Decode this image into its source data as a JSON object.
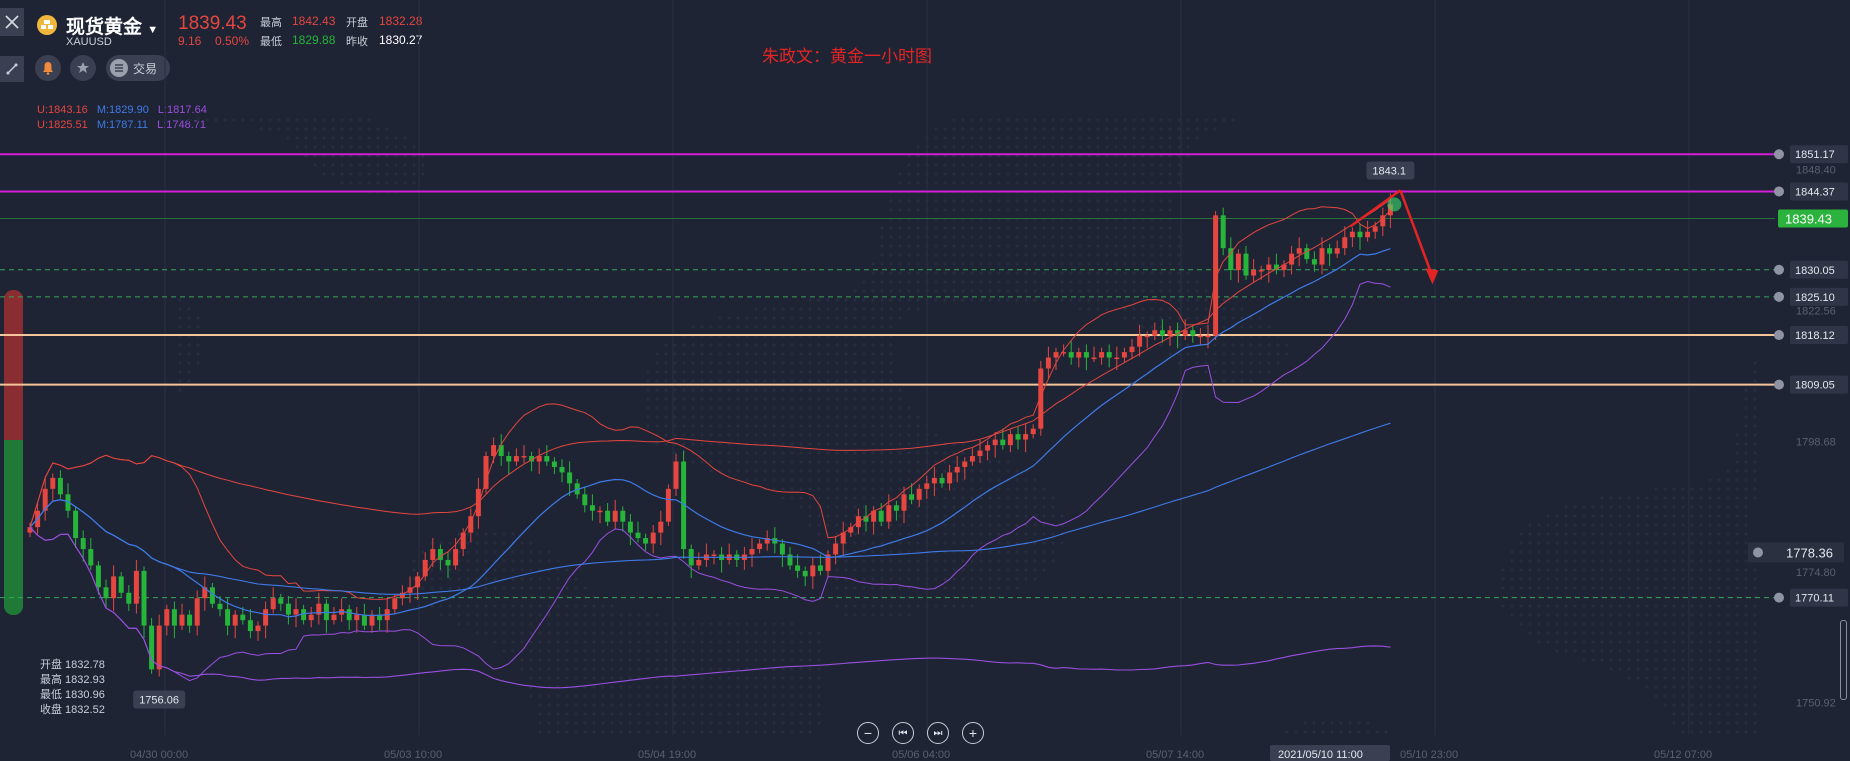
{
  "header": {
    "title": "现货黄金",
    "symbol": "XAUUSD",
    "price": "1839.43",
    "change": "9.16",
    "change_pct": "0.50%",
    "high_label": "最高",
    "high_value": "1842.43",
    "open_label": "开盘",
    "open_value": "1832.28",
    "low_label": "最低",
    "low_value": "1829.88",
    "prev_label": "昨收",
    "prev_value": "1830.27",
    "trade_label": "交易"
  },
  "annotation_title": "朱政文：黄金一小时图",
  "indicators": {
    "line1": {
      "u": "U:1843.16",
      "m": "M:1829.90",
      "l": "L:1817.64"
    },
    "line2": {
      "u": "U:1825.51",
      "m": "M:1787.11",
      "l": "L:1748.71"
    }
  },
  "ohlc_box": {
    "open": "开盘 1832.78",
    "high": "最高 1832.93",
    "low": "最低 1830.96",
    "close": "收盘 1832.52"
  },
  "colors": {
    "background": "#1e2434",
    "up": "#e5463f",
    "down": "#26b43a",
    "magenta_line": "#d21fd6",
    "orange_line": "#f4c49a",
    "bb_short_mid": "#3f7be8",
    "bb_short_band": "#e5463f",
    "bb_long_band": "#9b4fe0",
    "price_tag": "#2cb33d"
  },
  "chart_data": {
    "type": "candlestick",
    "title": "朱政文：黄金一小时图",
    "ylim": [
      1745,
      1862
    ],
    "y_ticks": [
      "1848.40",
      "1822.56",
      "1798.68",
      "1774.80",
      "1750.92"
    ],
    "x_ticks": [
      "04/30 00:00",
      "05/03 10:00",
      "05/04 19:00",
      "05/06 04:00",
      "05/07 14:00",
      "05/10 23:00",
      "05/12 07:00"
    ],
    "crosshair_time": "2021/05/10 11:00",
    "high_marker": "1843.1",
    "low_marker": "1756.06",
    "horizontal_levels": [
      {
        "value": 1851.17,
        "style": "solid",
        "color": "magenta",
        "label": "1851.17"
      },
      {
        "value": 1844.37,
        "style": "solid",
        "color": "magenta",
        "label": "1844.37"
      },
      {
        "value": 1839.43,
        "style": "solid",
        "color": "current",
        "label": "1839.43"
      },
      {
        "value": 1830.05,
        "style": "dashed",
        "color": "green",
        "label": "1830.05"
      },
      {
        "value": 1825.1,
        "style": "dashed",
        "color": "green",
        "label": "1825.10"
      },
      {
        "value": 1818.12,
        "style": "solid",
        "color": "orange",
        "label": "1818.12"
      },
      {
        "value": 1809.05,
        "style": "solid",
        "color": "orange",
        "label": "1809.05"
      },
      {
        "value": 1770.11,
        "style": "dashed",
        "color": "green",
        "label": "1770.11"
      }
    ],
    "side_price": "1778.36",
    "closes": [
      1783,
      1786,
      1790,
      1792,
      1789,
      1786,
      1781,
      1779,
      1776,
      1772,
      1770,
      1774,
      1771,
      1769,
      1775,
      1765,
      1757,
      1765,
      1768,
      1765,
      1767,
      1765,
      1770,
      1772,
      1769,
      1768,
      1765,
      1767,
      1766,
      1764,
      1765,
      1768,
      1770,
      1769,
      1767,
      1768,
      1766,
      1767,
      1769,
      1766,
      1767,
      1768,
      1766,
      1767,
      1765,
      1767,
      1766,
      1768,
      1770,
      1771,
      1772,
      1774,
      1777,
      1779,
      1777,
      1776,
      1779,
      1782,
      1785,
      1790,
      1796,
      1798,
      1796,
      1795,
      1796,
      1796,
      1795,
      1796,
      1795,
      1794,
      1793,
      1791,
      1789,
      1787,
      1786,
      1786,
      1784,
      1786,
      1784,
      1782,
      1781,
      1780,
      1782,
      1784,
      1790,
      1795,
      1779,
      1776,
      1777,
      1778,
      1778,
      1777,
      1778,
      1777,
      1778,
      1779,
      1780,
      1781,
      1780,
      1778,
      1776,
      1775,
      1774,
      1776,
      1775,
      1778,
      1780,
      1782,
      1783,
      1785,
      1784,
      1786,
      1784,
      1787,
      1786,
      1789,
      1788,
      1790,
      1791,
      1792,
      1791,
      1793,
      1794,
      1795,
      1796,
      1797,
      1798,
      1799,
      1798,
      1800,
      1799,
      1800,
      1801,
      1812,
      1814,
      1815,
      1815,
      1814,
      1815,
      1814,
      1814,
      1815,
      1814,
      1814,
      1815,
      1816,
      1818,
      1818,
      1819,
      1818,
      1819,
      1818,
      1819,
      1818,
      1818,
      1818,
      1840,
      1834,
      1830,
      1833,
      1829,
      1830,
      1830,
      1831,
      1830,
      1831,
      1833,
      1834,
      1832,
      1831,
      1834,
      1833,
      1834,
      1836,
      1837,
      1836,
      1837,
      1838,
      1840,
      1842
    ]
  }
}
